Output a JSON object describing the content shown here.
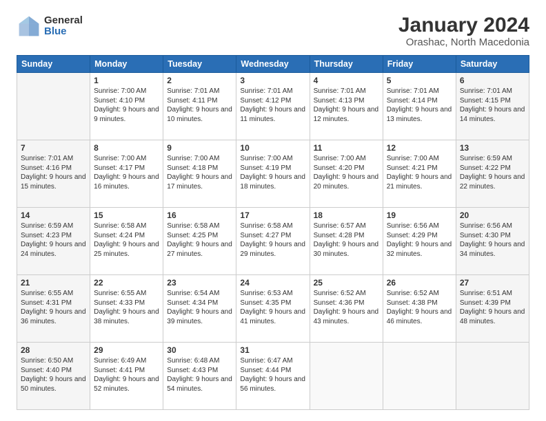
{
  "logo": {
    "general": "General",
    "blue": "Blue"
  },
  "header": {
    "title": "January 2024",
    "subtitle": "Orashac, North Macedonia"
  },
  "columns": [
    "Sunday",
    "Monday",
    "Tuesday",
    "Wednesday",
    "Thursday",
    "Friday",
    "Saturday"
  ],
  "weeks": [
    [
      {
        "day": "",
        "info": ""
      },
      {
        "day": "1",
        "info": "Sunrise: 7:00 AM\nSunset: 4:10 PM\nDaylight: 9 hours\nand 9 minutes."
      },
      {
        "day": "2",
        "info": "Sunrise: 7:01 AM\nSunset: 4:11 PM\nDaylight: 9 hours\nand 10 minutes."
      },
      {
        "day": "3",
        "info": "Sunrise: 7:01 AM\nSunset: 4:12 PM\nDaylight: 9 hours\nand 11 minutes."
      },
      {
        "day": "4",
        "info": "Sunrise: 7:01 AM\nSunset: 4:13 PM\nDaylight: 9 hours\nand 12 minutes."
      },
      {
        "day": "5",
        "info": "Sunrise: 7:01 AM\nSunset: 4:14 PM\nDaylight: 9 hours\nand 13 minutes."
      },
      {
        "day": "6",
        "info": "Sunrise: 7:01 AM\nSunset: 4:15 PM\nDaylight: 9 hours\nand 14 minutes."
      }
    ],
    [
      {
        "day": "7",
        "info": "Sunrise: 7:01 AM\nSunset: 4:16 PM\nDaylight: 9 hours\nand 15 minutes."
      },
      {
        "day": "8",
        "info": "Sunrise: 7:00 AM\nSunset: 4:17 PM\nDaylight: 9 hours\nand 16 minutes."
      },
      {
        "day": "9",
        "info": "Sunrise: 7:00 AM\nSunset: 4:18 PM\nDaylight: 9 hours\nand 17 minutes."
      },
      {
        "day": "10",
        "info": "Sunrise: 7:00 AM\nSunset: 4:19 PM\nDaylight: 9 hours\nand 18 minutes."
      },
      {
        "day": "11",
        "info": "Sunrise: 7:00 AM\nSunset: 4:20 PM\nDaylight: 9 hours\nand 20 minutes."
      },
      {
        "day": "12",
        "info": "Sunrise: 7:00 AM\nSunset: 4:21 PM\nDaylight: 9 hours\nand 21 minutes."
      },
      {
        "day": "13",
        "info": "Sunrise: 6:59 AM\nSunset: 4:22 PM\nDaylight: 9 hours\nand 22 minutes."
      }
    ],
    [
      {
        "day": "14",
        "info": "Sunrise: 6:59 AM\nSunset: 4:23 PM\nDaylight: 9 hours\nand 24 minutes."
      },
      {
        "day": "15",
        "info": "Sunrise: 6:58 AM\nSunset: 4:24 PM\nDaylight: 9 hours\nand 25 minutes."
      },
      {
        "day": "16",
        "info": "Sunrise: 6:58 AM\nSunset: 4:25 PM\nDaylight: 9 hours\nand 27 minutes."
      },
      {
        "day": "17",
        "info": "Sunrise: 6:58 AM\nSunset: 4:27 PM\nDaylight: 9 hours\nand 29 minutes."
      },
      {
        "day": "18",
        "info": "Sunrise: 6:57 AM\nSunset: 4:28 PM\nDaylight: 9 hours\nand 30 minutes."
      },
      {
        "day": "19",
        "info": "Sunrise: 6:56 AM\nSunset: 4:29 PM\nDaylight: 9 hours\nand 32 minutes."
      },
      {
        "day": "20",
        "info": "Sunrise: 6:56 AM\nSunset: 4:30 PM\nDaylight: 9 hours\nand 34 minutes."
      }
    ],
    [
      {
        "day": "21",
        "info": "Sunrise: 6:55 AM\nSunset: 4:31 PM\nDaylight: 9 hours\nand 36 minutes."
      },
      {
        "day": "22",
        "info": "Sunrise: 6:55 AM\nSunset: 4:33 PM\nDaylight: 9 hours\nand 38 minutes."
      },
      {
        "day": "23",
        "info": "Sunrise: 6:54 AM\nSunset: 4:34 PM\nDaylight: 9 hours\nand 39 minutes."
      },
      {
        "day": "24",
        "info": "Sunrise: 6:53 AM\nSunset: 4:35 PM\nDaylight: 9 hours\nand 41 minutes."
      },
      {
        "day": "25",
        "info": "Sunrise: 6:52 AM\nSunset: 4:36 PM\nDaylight: 9 hours\nand 43 minutes."
      },
      {
        "day": "26",
        "info": "Sunrise: 6:52 AM\nSunset: 4:38 PM\nDaylight: 9 hours\nand 46 minutes."
      },
      {
        "day": "27",
        "info": "Sunrise: 6:51 AM\nSunset: 4:39 PM\nDaylight: 9 hours\nand 48 minutes."
      }
    ],
    [
      {
        "day": "28",
        "info": "Sunrise: 6:50 AM\nSunset: 4:40 PM\nDaylight: 9 hours\nand 50 minutes."
      },
      {
        "day": "29",
        "info": "Sunrise: 6:49 AM\nSunset: 4:41 PM\nDaylight: 9 hours\nand 52 minutes."
      },
      {
        "day": "30",
        "info": "Sunrise: 6:48 AM\nSunset: 4:43 PM\nDaylight: 9 hours\nand 54 minutes."
      },
      {
        "day": "31",
        "info": "Sunrise: 6:47 AM\nSunset: 4:44 PM\nDaylight: 9 hours\nand 56 minutes."
      },
      {
        "day": "",
        "info": ""
      },
      {
        "day": "",
        "info": ""
      },
      {
        "day": "",
        "info": ""
      }
    ]
  ]
}
